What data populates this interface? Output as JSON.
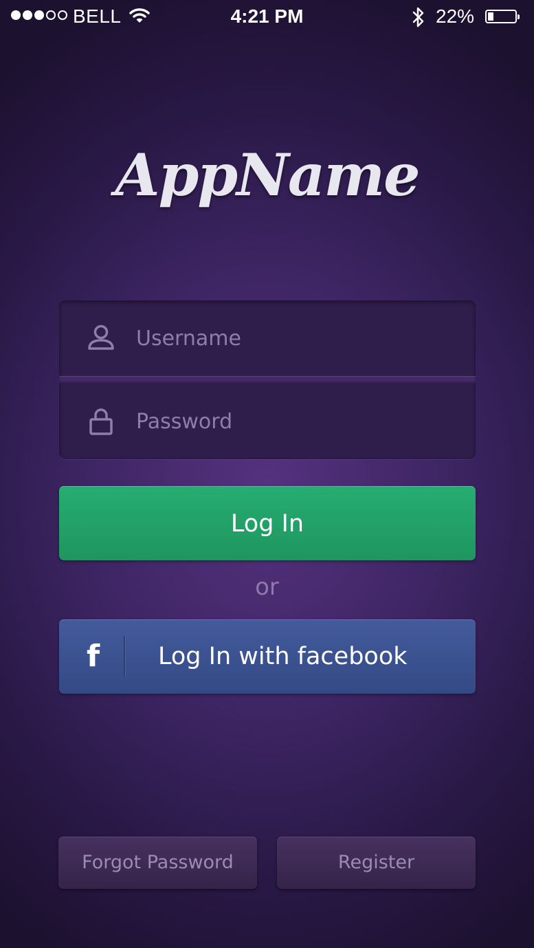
{
  "status_bar": {
    "carrier": "BELL",
    "signal_strength": 3,
    "signal_max": 5,
    "time": "4:21 PM",
    "battery_percent": "22%",
    "battery_level": 0.22
  },
  "logo": {
    "text": "AppName"
  },
  "form": {
    "username": {
      "placeholder": "Username",
      "value": "",
      "icon": "user-icon"
    },
    "password": {
      "placeholder": "Password",
      "value": "",
      "icon": "lock-icon"
    }
  },
  "buttons": {
    "login_label": "Log In",
    "or_text": "or",
    "facebook_icon": "f",
    "facebook_label": "Log In with facebook",
    "forgot_label": "Forgot Password",
    "register_label": "Register"
  },
  "colors": {
    "login_green": "#22a168",
    "facebook_blue": "#3b5291",
    "background_purple": "#3c2461"
  }
}
